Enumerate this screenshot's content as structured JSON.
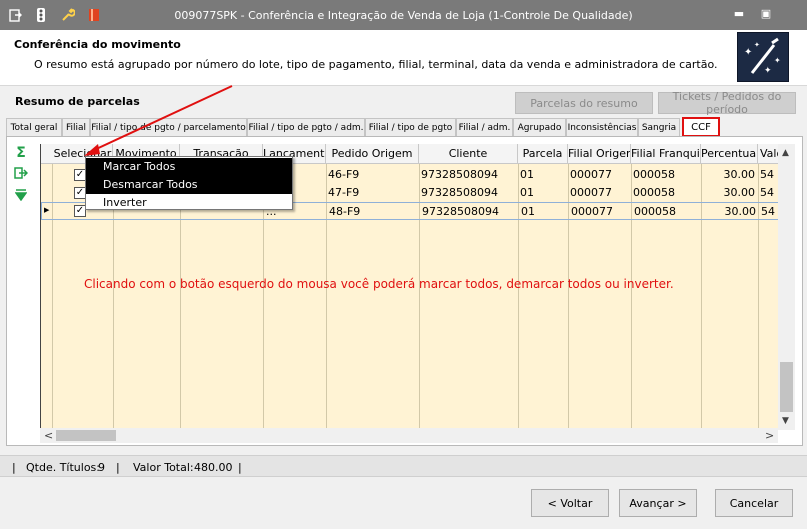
{
  "window": {
    "title": "009077SPK - Conferência e Integração de Venda de Loja (1-Controle De Qualidade)",
    "minimize_glyph": "▬",
    "maximize_glyph": "▣"
  },
  "header": {
    "title": "Conferência do movimento",
    "description": "O resumo está agrupado por número do lote, tipo de pagamento, filial, terminal, data da venda e administradora de cartão."
  },
  "section": {
    "title": "Resumo de parcelas",
    "btn_parcelas": "Parcelas do resumo",
    "btn_tickets": "Tickets / Pedidos do período"
  },
  "tabs": [
    "Total geral",
    "Filial",
    "Filial / tipo de pgto / parcelamento",
    "Filial / tipo de pgto / adm.",
    "Filial / tipo de pgto",
    "Filial / adm.",
    "Agrupado",
    "Inconsistências",
    "Sangria",
    "CCF"
  ],
  "grid": {
    "columns": [
      "Selecionar",
      "Movimento",
      "Transação",
      "Lançamento",
      "Pedido Origem",
      "Cliente",
      "Parcela",
      "Filial Origem",
      "Filial Franquia",
      "Percentual",
      "Valo"
    ],
    "rows": [
      {
        "checked": "✓",
        "movimento": "",
        "transacao": "",
        "lancamento": "",
        "pedido": "46-F9",
        "cliente": "97328508094",
        "parcela": "01",
        "filial_origem": "000077",
        "filial_franquia": "000058",
        "percentual": "30.00",
        "valor": "54"
      },
      {
        "checked": "✓",
        "movimento": "",
        "transacao": "",
        "lancamento": "",
        "pedido": "47-F9",
        "cliente": "97328508094",
        "parcela": "01",
        "filial_origem": "000077",
        "filial_franquia": "000058",
        "percentual": "30.00",
        "valor": "54"
      },
      {
        "checked": "✓",
        "movimento": "",
        "transacao": "",
        "lancamento": "...",
        "pedido": "48-F9",
        "cliente": "97328508094",
        "parcela": "01",
        "filial_origem": "000077",
        "filial_franquia": "000058",
        "percentual": "30.00",
        "valor": "54"
      }
    ],
    "current_row_glyph": "▶",
    "scroll_up": "▲",
    "scroll_down": "▼",
    "scroll_left": "<",
    "scroll_right": ">"
  },
  "context_menu": {
    "items": [
      "Marcar Todos",
      "Desmarcar Todos",
      "Inverter"
    ]
  },
  "annotation": {
    "text": "Clicando com o botão esquerdo do mousa você poderá marcar todos, demarcar todos ou inverter."
  },
  "status": {
    "qtde_label": "Qtde. Títulos:",
    "qtde_value": "9",
    "sep": "|",
    "total_label": "Valor Total:",
    "total_value": "480.00"
  },
  "footer": {
    "back": "< Voltar",
    "next": "Avançar >",
    "cancel": "Cancelar"
  },
  "icons": {
    "sum": "Σ",
    "export": "⇨",
    "filter": "⧩"
  },
  "colors": {
    "annotation": "#e01010",
    "grid_bg": "#fff3d4",
    "titlebar": "#7a7a7a"
  }
}
